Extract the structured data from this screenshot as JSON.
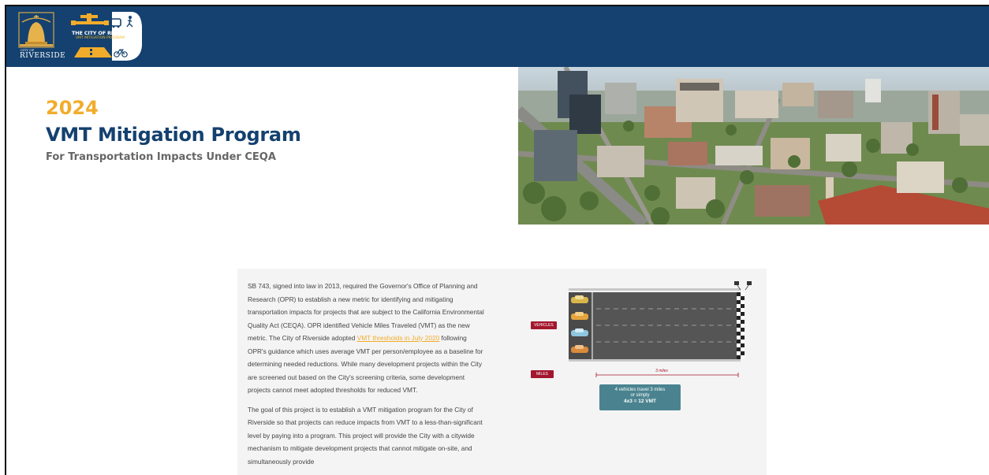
{
  "header": {
    "city_logo": {
      "small_text": "CITY OF",
      "name": "RIVERSIDE"
    },
    "program_logo": {
      "title": "THE CITY OF RIVERSIDE",
      "subtitle": "VMT MITIGATION PROGRAM"
    }
  },
  "hero": {
    "year": "2024",
    "title": "VMT Mitigation Program",
    "subtitle": "For Transportation Impacts Under CEQA",
    "image": "aerial-city-photo"
  },
  "content": {
    "paragraph1_before": "SB 743, signed into law in 2013, required the Governor's Office of Planning and Research (OPR) to establish a new metric for identifying and mitigating transportation impacts for projects that are subject to the California Environmental Quality Act (CEQA). OPR identified Vehicle Miles Traveled (VMT) as the new metric. The City of Riverside adopted ",
    "paragraph1_link": "VMT thresholds in July 2020",
    "paragraph1_after": " following OPR's guidance which uses average VMT per person/employee as a baseline for determining needed reductions. While many development projects within the City are screened out based on the City's screening criteria, some development projects cannot meet adopted thresholds for reduced VMT.",
    "paragraph2": "The goal of this project is to establish a VMT mitigation program for the City of Riverside so that projects can reduce impacts from VMT to a less-than-significant level by paying into a program. This project will provide the City with a citywide mechanism to mitigate development projects that cannot mitigate on-site, and simultaneously provide"
  },
  "diagram": {
    "vehicles_label": "VEHICLES",
    "miles_label": "MILES",
    "distance_label": "3 miles",
    "callout_line1": "4 vehicles travel 3 miles",
    "callout_line2": "or simply",
    "callout_formula": "4x3 = 12 VMT",
    "car_colors": [
      "#d9b64a",
      "#e5a53c",
      "#8ec6e0",
      "#d98a3a"
    ]
  }
}
